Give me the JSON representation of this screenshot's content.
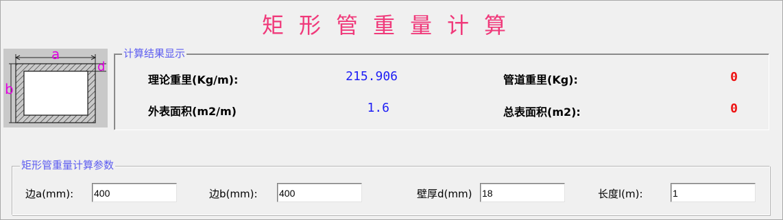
{
  "title": "矩形管重量计算",
  "diagram": {
    "label_a": "a",
    "label_b": "b",
    "label_d": "d"
  },
  "results": {
    "group_label": "计算结果显示",
    "theoretical_weight_label": "理论重里(Kg/m):",
    "theoretical_weight_value": "215.906",
    "pipe_weight_label": "管道重里(Kg):",
    "pipe_weight_value": "0",
    "outer_area_label": "外表面积(m2/m)",
    "outer_area_value": "1.6",
    "total_area_label": "总表面积(m2):",
    "total_area_value": "0"
  },
  "params": {
    "group_label": "矩形管重量计算参数",
    "side_a_label": "边a(mm):",
    "side_a_value": "400",
    "side_b_label": "边b(mm):",
    "side_b_value": "400",
    "thickness_label": "壁厚d(mm)",
    "thickness_value": "18",
    "length_label": "长度l(m):",
    "length_value": "1"
  },
  "colors": {
    "title": "#f0397a",
    "group_label": "#5d5df0",
    "value_blue": "#1d1df5",
    "value_red": "#ee1111",
    "diagram_magenta": "#e000e0"
  }
}
